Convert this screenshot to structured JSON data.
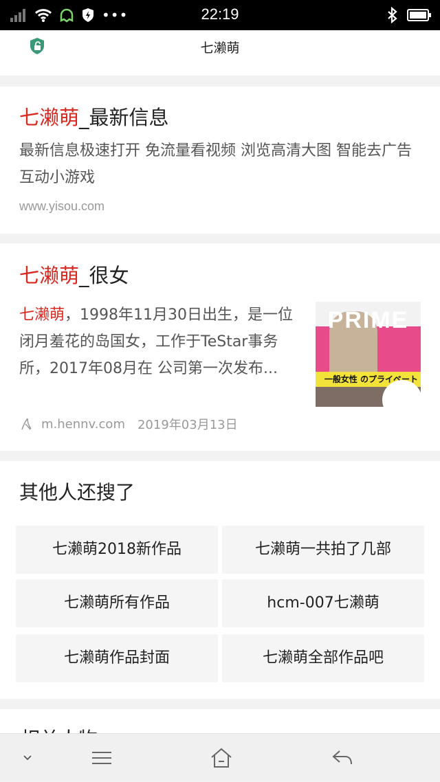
{
  "status_bar": {
    "time": "22:19",
    "icons": [
      "signal-icon",
      "wifi-icon",
      "ghost-icon",
      "shield-check-icon",
      "more-dots-icon",
      "bluetooth-icon",
      "battery-icon"
    ]
  },
  "topbar": {
    "title": "七濑萌",
    "icon": "shield-lock-icon"
  },
  "results": [
    {
      "title_highlight": "七濑萌",
      "title_rest": "_最新信息",
      "snippet": "最新信息极速打开 免流量看视频 浏览高清大图 智能去广告 互动小游戏",
      "url": "www.yisou.com"
    },
    {
      "title_highlight": "七濑萌",
      "title_rest": "_很女",
      "snippet_highlight": "七濑萌",
      "snippet_rest": "，1998年11月30日出生，是一位闭月羞花的岛国女，工作于TeStar事务所，2017年08月在 公司第一次发布...",
      "url": "m.hennv.com",
      "date": "2019年03月13日",
      "thumbnail_text": "PRIME",
      "thumbnail_strip": "一般女性 のプライベート SEX"
    }
  ],
  "related": {
    "title": "其他人还搜了",
    "items": [
      "七濑萌2018新作品",
      "七濑萌一共拍了几部",
      "七濑萌所有作品",
      "hcm-007七濑萌",
      "七濑萌作品封面",
      "七濑萌全部作品吧"
    ]
  },
  "next_section": {
    "title_partial": "相关人物"
  },
  "bottom_nav": {
    "items": [
      "chevron-down-icon",
      "menu-icon",
      "home-icon",
      "back-icon"
    ]
  },
  "colors": {
    "highlight": "#d8281f",
    "status_bar": "#000000",
    "shield": "#3a9a78"
  }
}
